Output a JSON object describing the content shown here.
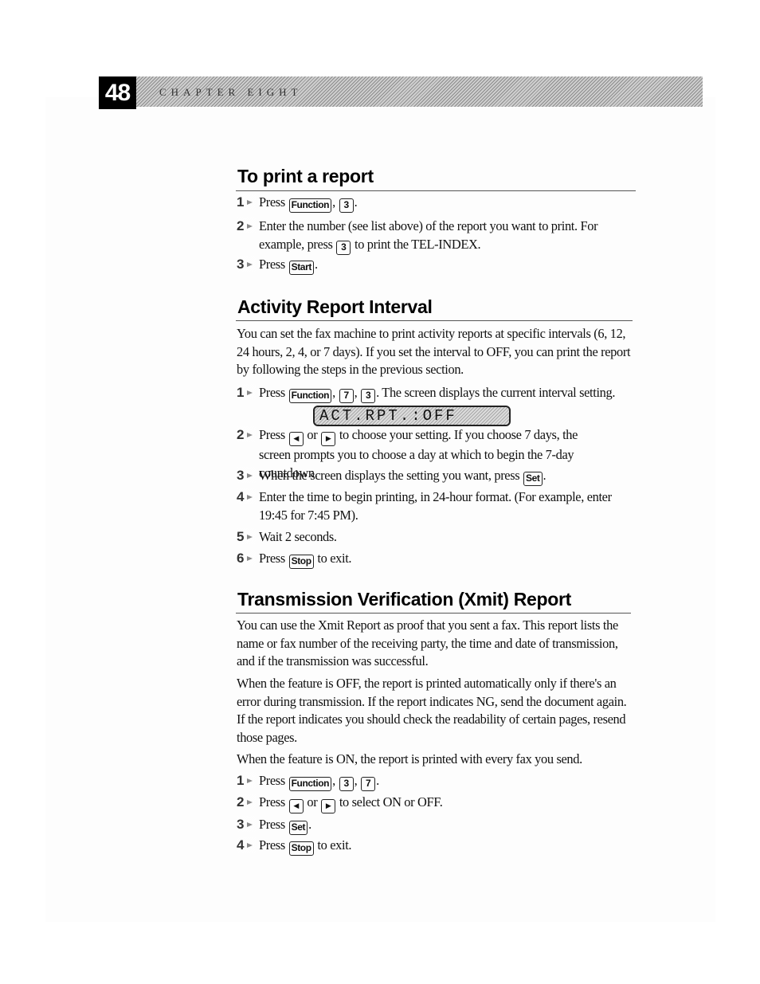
{
  "header": {
    "page_number": "48",
    "chapter_title": "CHAPTER EIGHT"
  },
  "sections": [
    {
      "heading": "To print a report",
      "steps": [
        {
          "num": "1",
          "parts": [
            "Press",
            "Function",
            ",",
            "3",
            "."
          ]
        },
        {
          "num": "2",
          "text_before": "Enter the number (see list above) of the report you want to print. For example, press",
          "key": "3",
          "text_after": "to print the TEL-INDEX."
        },
        {
          "num": "3",
          "text_before": "Press",
          "key": "Start",
          "text_after": "."
        }
      ]
    },
    {
      "heading": "Activity Report Interval",
      "intro": "You can set the fax machine to print activity reports at specific intervals (6, 12, 24 hours, 2, 4, or 7 days). If you set the interval to OFF, you can print the report by following the steps in the previous section.",
      "lcd_display": "ACT.RPT.:OFF",
      "steps": [
        {
          "num": "1",
          "text_before": "Press",
          "keys": [
            "Function",
            "7",
            "3"
          ],
          "text_after": "The screen displays the current interval setting."
        },
        {
          "num": "2",
          "text_before": "Press",
          "keys": [
            "◀",
            "▶"
          ],
          "connector": "or",
          "text_after": "to choose your setting. If you choose 7 days, the screen prompts you to choose a day at which to begin the 7-day countdown."
        },
        {
          "num": "3",
          "text_before": "When the screen displays the setting you want, press",
          "key": "Set",
          "text_after": "."
        },
        {
          "num": "4",
          "text": "Enter the time to begin printing, in 24-hour format. (For example, enter 19:45 for 7:45 PM)."
        },
        {
          "num": "5",
          "text": "Wait 2 seconds."
        },
        {
          "num": "6",
          "text_before": "Press",
          "key": "Stop",
          "text_after": "to exit."
        }
      ]
    },
    {
      "heading": "Transmission Verification (Xmit) Report",
      "paragraphs": [
        "You can use the Xmit Report as proof that you sent a fax. This report lists the name or fax number of the receiving party, the time and date of transmission, and if the transmission was successful.",
        "When the feature is OFF, the report is printed automatically only if there's an error during transmission. If the report indicates NG, send the document again. If the report indicates you should check the readability of certain pages, resend those pages.",
        "When the feature is ON, the report is printed with every fax you send."
      ],
      "steps": [
        {
          "num": "1",
          "text_before": "Press",
          "keys": [
            "Function",
            "3",
            "7"
          ],
          "text_after": "."
        },
        {
          "num": "2",
          "text_before": "Press",
          "keys": [
            "◀",
            "▶"
          ],
          "connector": "or",
          "text_after": "to select ON or OFF."
        },
        {
          "num": "3",
          "text_before": "Press",
          "key": "Set",
          "text_after": "."
        },
        {
          "num": "4",
          "text_before": "Press",
          "key": "Stop",
          "text_after": "to exit."
        }
      ]
    }
  ]
}
